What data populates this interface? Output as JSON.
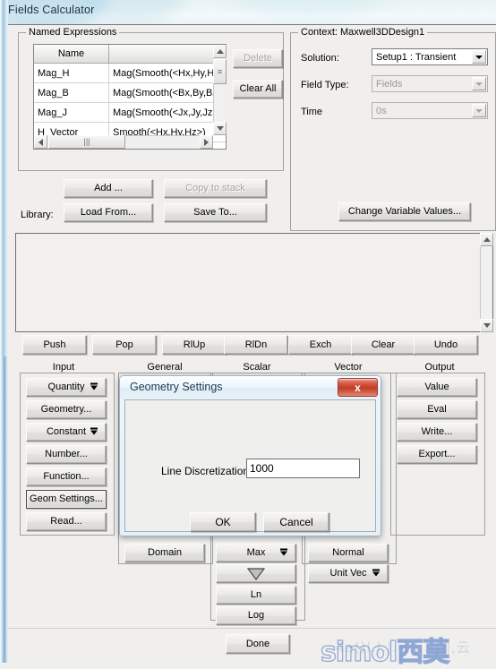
{
  "window": {
    "title": "Fields Calculator"
  },
  "named_expressions": {
    "group_label": "Named Expressions",
    "columns": [
      "Name",
      ""
    ],
    "rows": [
      {
        "name": "Mag_H",
        "expression": "Mag(Smooth(<Hx,Hy,Hz>))"
      },
      {
        "name": "Mag_B",
        "expression": "Mag(Smooth(<Bx,By,Bz>))"
      },
      {
        "name": "Mag_J",
        "expression": "Mag(Smooth(<Jx,Jy,Jz>))"
      },
      {
        "name": "H_Vector",
        "expression": "Smooth(<Hx,Hy,Hz>)"
      }
    ],
    "delete_label": "Delete",
    "clear_all_label": "Clear All",
    "add_label": "Add ...",
    "copy_to_stack_label": "Copy to stack",
    "library_label": "Library:",
    "load_from_label": "Load From...",
    "save_to_label": "Save To..."
  },
  "context": {
    "group_label": "Context: Maxwell3DDesign1",
    "solution_label": "Solution:",
    "solution_value": "Setup1 : Transient",
    "field_type_label": "Field Type:",
    "field_type_value": "Fields",
    "time_label": "Time",
    "time_value": "0s",
    "change_variable_values_label": "Change Variable Values..."
  },
  "stack_toolbar": {
    "buttons": [
      "Push",
      "Pop",
      "RlUp",
      "RlDn",
      "Exch",
      "Clear",
      "Undo"
    ]
  },
  "columns": {
    "input": "Input",
    "general": "General",
    "scalar": "Scalar",
    "vector": "Vector",
    "output": "Output"
  },
  "input_buttons": [
    {
      "label": "Quantity",
      "dropdown": true
    },
    {
      "label": "Geometry...",
      "dropdown": false
    },
    {
      "label": "Constant",
      "dropdown": true
    },
    {
      "label": "Number...",
      "dropdown": false
    },
    {
      "label": "Function...",
      "dropdown": false
    },
    {
      "label": "Geom Settings...",
      "dropdown": false,
      "focused": true
    },
    {
      "label": "Read...",
      "dropdown": false
    }
  ],
  "output_buttons": [
    {
      "label": "Value"
    },
    {
      "label": "Eval"
    },
    {
      "label": "Write..."
    },
    {
      "label": "Export..."
    }
  ],
  "general_buttons": [
    {
      "label": "Domain"
    }
  ],
  "scalar_buttons": [
    {
      "label": "Max",
      "dropdown": true
    },
    {
      "label": "",
      "icon": "nabla-triangle-icon"
    },
    {
      "label": "Ln"
    },
    {
      "label": "Log"
    }
  ],
  "vector_buttons": [
    {
      "label": "Normal"
    },
    {
      "label": "Unit Vec",
      "dropdown": true
    }
  ],
  "footer": {
    "done_label": "Done"
  },
  "dialog": {
    "title": "Geometry Settings",
    "close_label": "x",
    "field_label": "Line Discretization:",
    "field_value": "1000",
    "ok_label": "OK",
    "cancel_label": "Cancel",
    "close_button_color": "#c23b26"
  },
  "watermark": {
    "text": "simol西莫",
    "sub_text": "4a()l.|.|.-|.|,.-|.|,云"
  }
}
